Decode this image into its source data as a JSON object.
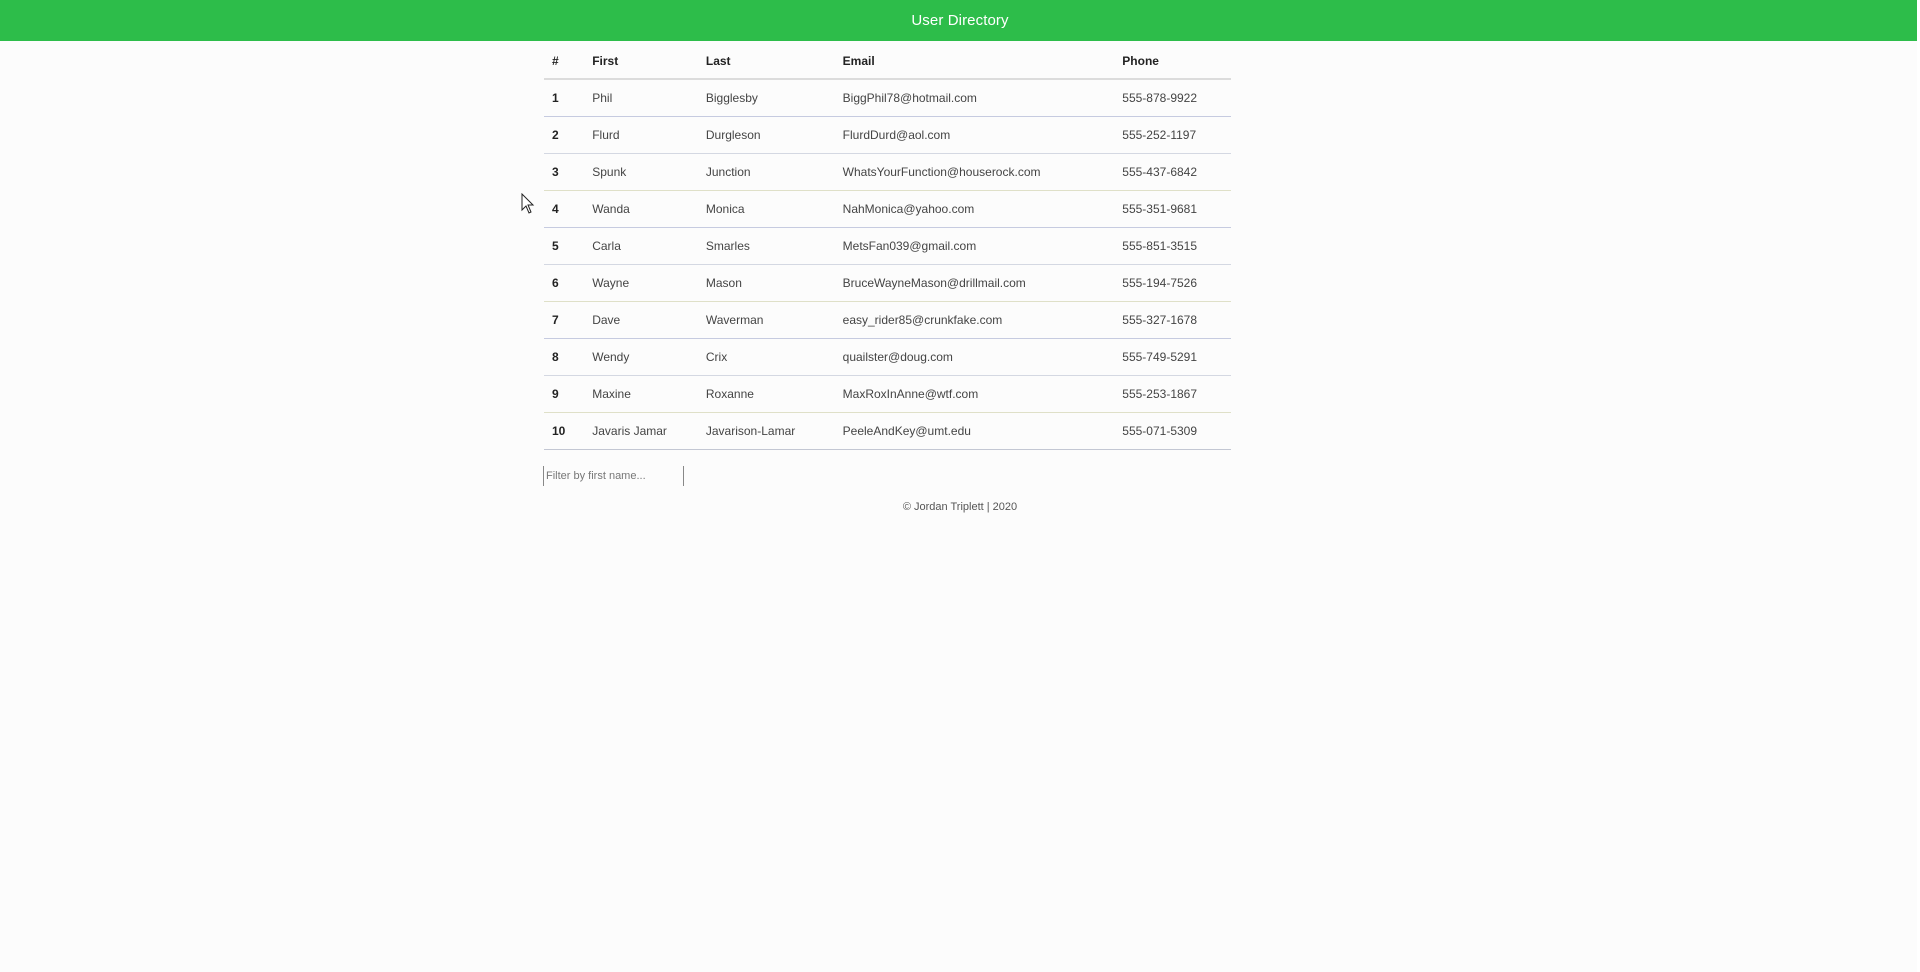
{
  "header": {
    "title": "User Directory"
  },
  "table": {
    "columns": [
      "#",
      "First",
      "Last",
      "Email",
      "Phone"
    ],
    "rows": [
      {
        "num": "1",
        "first": "Phil",
        "last": "Bigglesby",
        "email": "BiggPhil78@hotmail.com",
        "phone": "555-878-9922"
      },
      {
        "num": "2",
        "first": "Flurd",
        "last": "Durgleson",
        "email": "FlurdDurd@aol.com",
        "phone": "555-252-1197"
      },
      {
        "num": "3",
        "first": "Spunk",
        "last": "Junction",
        "email": "WhatsYourFunction@houserock.com",
        "phone": "555-437-6842"
      },
      {
        "num": "4",
        "first": "Wanda",
        "last": "Monica",
        "email": "NahMonica@yahoo.com",
        "phone": "555-351-9681"
      },
      {
        "num": "5",
        "first": "Carla",
        "last": "Smarles",
        "email": "MetsFan039@gmail.com",
        "phone": "555-851-3515"
      },
      {
        "num": "6",
        "first": "Wayne",
        "last": "Mason",
        "email": "BruceWayneMason@drillmail.com",
        "phone": "555-194-7526"
      },
      {
        "num": "7",
        "first": "Dave",
        "last": "Waverman",
        "email": "easy_rider85@crunkfake.com",
        "phone": "555-327-1678"
      },
      {
        "num": "8",
        "first": "Wendy",
        "last": "Crix",
        "email": "quailster@doug.com",
        "phone": "555-749-5291"
      },
      {
        "num": "9",
        "first": "Maxine",
        "last": "Roxanne",
        "email": "MaxRoxInAnne@wtf.com",
        "phone": "555-253-1867"
      },
      {
        "num": "10",
        "first": "Javaris Jamar",
        "last": "Javarison-Lamar",
        "email": "PeeleAndKey@umt.edu",
        "phone": "555-071-5309"
      }
    ]
  },
  "filter": {
    "placeholder": "Filter by first name...",
    "value": ""
  },
  "footer": {
    "text": "© Jordan Triplett | 2020"
  },
  "colors": {
    "header_bg": "#2dbd4a",
    "header_text": "#ffffff",
    "page_bg": "#fcfcfc"
  },
  "icons": {
    "cursor": "mouse-pointer-icon"
  }
}
